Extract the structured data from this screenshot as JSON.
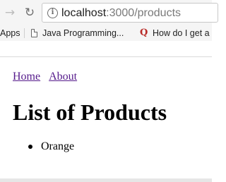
{
  "browser": {
    "forward_icon": "arrow-right-icon",
    "reload_icon": "reload-icon",
    "address_bar": {
      "info_icon": "info-icon",
      "host": "localhost",
      "rest": ":3000/products"
    },
    "bookmarks": [
      {
        "label": "Apps",
        "icon": "apps-icon"
      },
      {
        "label": "Java Programming...",
        "icon": "document-icon"
      },
      {
        "label": "How do I get a",
        "icon": "quora-icon"
      }
    ]
  },
  "page": {
    "nav": {
      "home": "Home",
      "about": "About"
    },
    "title": "List of Products",
    "products": [
      "Orange"
    ]
  },
  "colors": {
    "link": "#551a8b",
    "chrome_background": "#f5f5f5",
    "quora_brand": "#b92b27"
  }
}
